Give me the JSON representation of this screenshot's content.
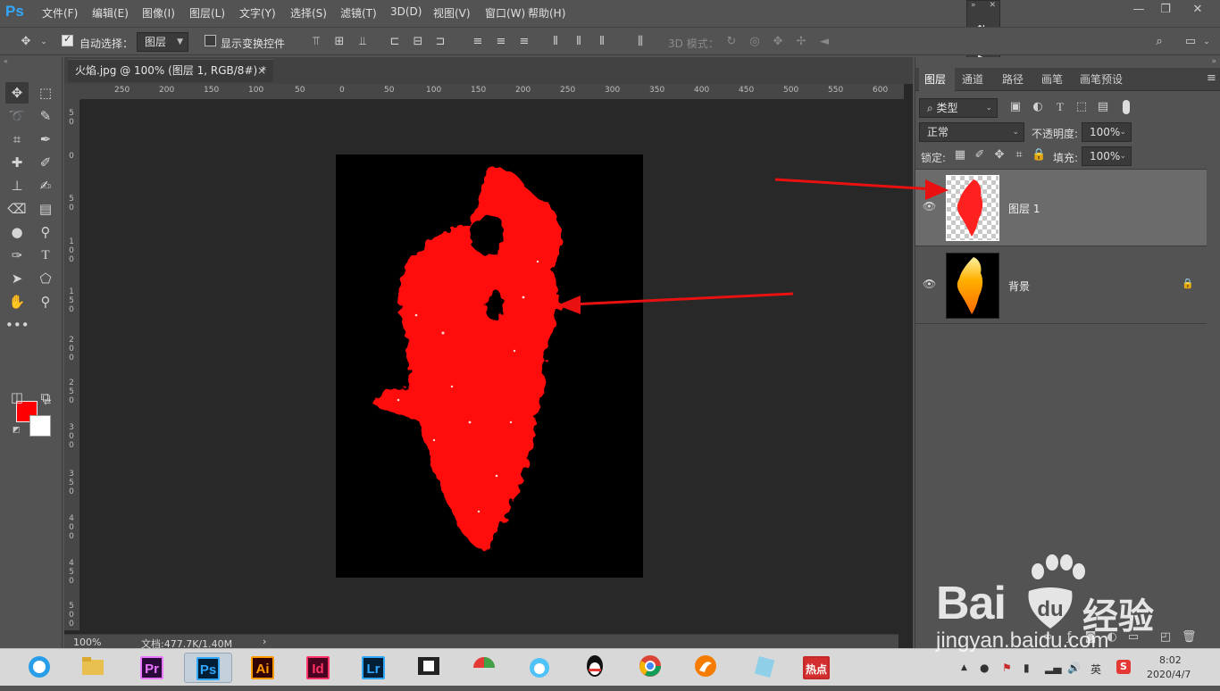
{
  "app": {
    "logo": "Ps"
  },
  "menubar": {
    "items": [
      "文件(F)",
      "编辑(E)",
      "图像(I)",
      "图层(L)",
      "文字(Y)",
      "选择(S)",
      "滤镜(T)",
      "3D(D)",
      "视图(V)",
      "窗口(W)",
      "帮助(H)"
    ],
    "window_controls": {
      "minimize": "—",
      "restore": "❐",
      "close": "✕"
    }
  },
  "options_bar": {
    "auto_select_label": "自动选择：",
    "auto_select_checked": true,
    "auto_select_value": "图层",
    "show_transform_label": "显示变换控件",
    "show_transform_checked": false,
    "mode_3d_label": "3D 模式："
  },
  "document": {
    "tab_title": "火焰.jpg @ 100% (图层 1, RGB/8#) *",
    "tab_close": "×",
    "zoom": "100%",
    "doc_info": "文档:477.7K/1.40M",
    "ruler_h_ticks": [
      "250",
      "200",
      "150",
      "100",
      "50",
      "0",
      "50",
      "100",
      "150",
      "200",
      "250",
      "300",
      "350",
      "400",
      "450",
      "500",
      "550",
      "600"
    ],
    "ruler_v_ticks": [
      "50",
      "0",
      "50",
      "100",
      "150",
      "200",
      "250",
      "300",
      "350",
      "400",
      "450",
      "500",
      "550"
    ]
  },
  "layers_panel": {
    "tabs": [
      "图层",
      "通道",
      "路径",
      "画笔",
      "画笔预设"
    ],
    "active_tab": "图层",
    "filter_kind": "类型",
    "blend_mode": "正常",
    "opacity_label": "不透明度:",
    "opacity_value": "100%",
    "lock_label": "锁定:",
    "fill_label": "填充:",
    "fill_value": "100%",
    "layers": [
      {
        "name": "图层 1",
        "selected": true,
        "visible": true,
        "locked": false
      },
      {
        "name": "背景",
        "selected": false,
        "visible": true,
        "locked": true
      }
    ]
  },
  "colors": {
    "foreground": "#ff0000",
    "background": "#ffffff",
    "accent": "#31a8ff",
    "arrow": "#e81010"
  },
  "taskbar": {
    "apps": [
      {
        "icon": "browser-icon",
        "label": ""
      },
      {
        "icon": "file-explorer-icon",
        "label": ""
      },
      {
        "icon": "premiere-icon",
        "label": "Pr",
        "color": "#ea77ff"
      },
      {
        "icon": "photoshop-icon",
        "label": "Ps",
        "color": "#31a8ff"
      },
      {
        "icon": "illustrator-icon",
        "label": "Ai",
        "color": "#ff9a00"
      },
      {
        "icon": "indesign-icon",
        "label": "Id",
        "color": "#ff3366"
      },
      {
        "icon": "lightroom-icon",
        "label": "Lr",
        "color": "#31a8ff"
      },
      {
        "icon": "video-editor-icon",
        "label": ""
      },
      {
        "icon": "umbrella-app-icon",
        "label": ""
      },
      {
        "icon": "cat-app-icon",
        "label": ""
      },
      {
        "icon": "qq-icon",
        "label": ""
      },
      {
        "icon": "chrome-icon",
        "label": ""
      },
      {
        "icon": "fox-app-icon",
        "label": ""
      },
      {
        "icon": "notes-app-icon",
        "label": ""
      },
      {
        "icon": "news-app-icon",
        "label": "热点"
      }
    ],
    "tray_ime": "英",
    "time": "8:02",
    "date": "2020/4/7"
  },
  "watermark": {
    "brand": "Bai",
    "brand2": "经验",
    "url": "jingyan.baidu.com"
  }
}
